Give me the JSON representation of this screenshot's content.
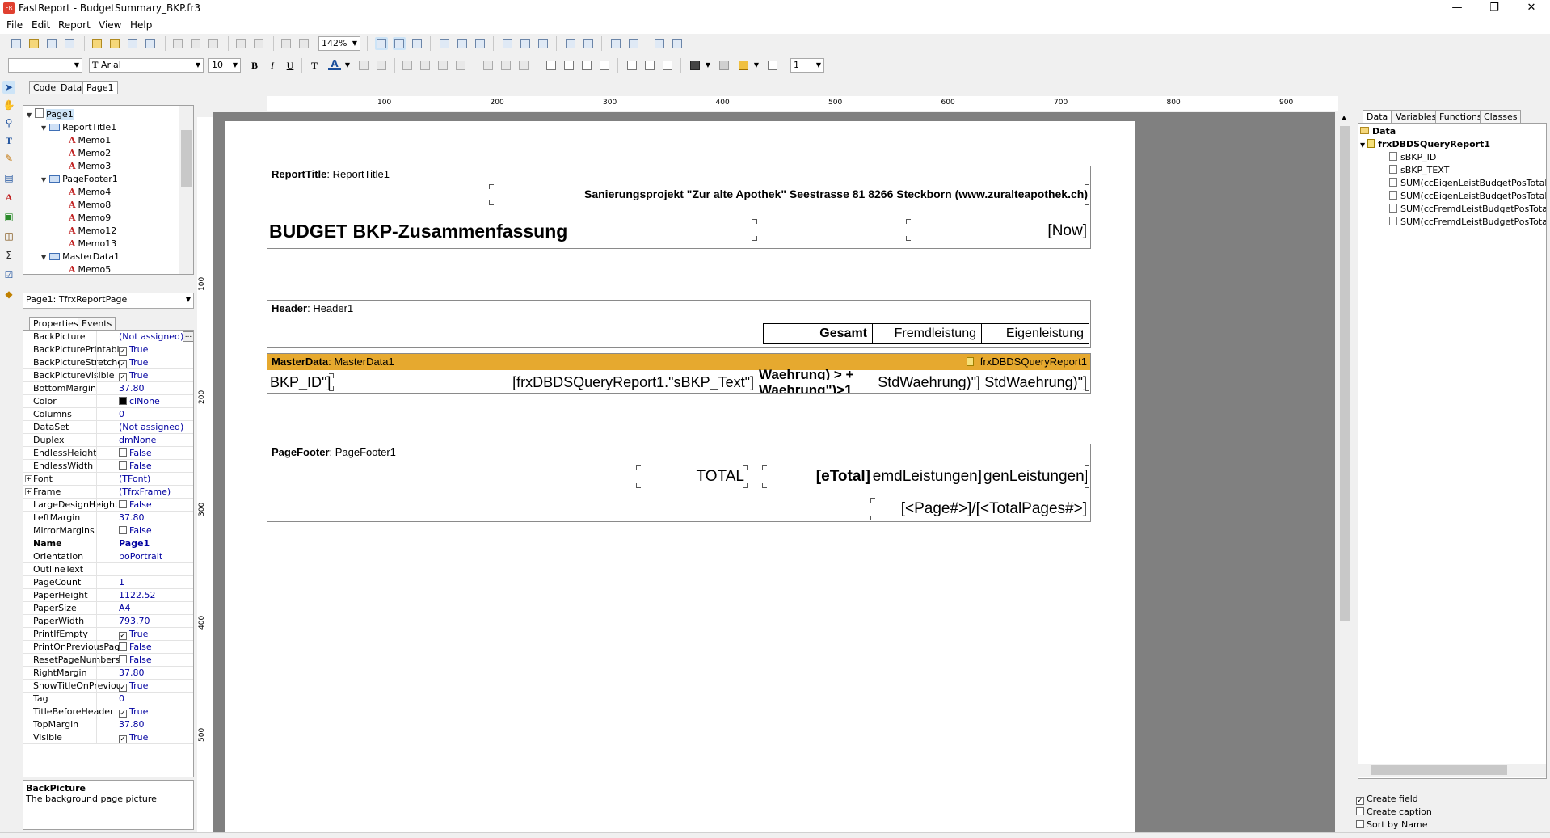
{
  "window": {
    "title": "FastReport - BudgetSummary_BKP.fr3",
    "app_icon": "FR"
  },
  "menu": [
    "File",
    "Edit",
    "Report",
    "View",
    "Help"
  ],
  "toolbar": {
    "zoom": "142%"
  },
  "format_toolbar": {
    "style_combo": "",
    "font_name": "Arial",
    "font_size": "10",
    "bold": "B",
    "italic": "I",
    "underline": "U",
    "frame_width": "1"
  },
  "designer_tabs": [
    "Code",
    "Data",
    "Page1"
  ],
  "report_tree": [
    {
      "label": "Page1",
      "level": 0,
      "type": "page",
      "expanded": true
    },
    {
      "label": "ReportTitle1",
      "level": 1,
      "type": "band",
      "expanded": true
    },
    {
      "label": "Memo1",
      "level": 2,
      "type": "memo"
    },
    {
      "label": "Memo2",
      "level": 2,
      "type": "memo"
    },
    {
      "label": "Memo3",
      "level": 2,
      "type": "memo"
    },
    {
      "label": "PageFooter1",
      "level": 1,
      "type": "band",
      "expanded": true
    },
    {
      "label": "Memo4",
      "level": 2,
      "type": "memo"
    },
    {
      "label": "Memo8",
      "level": 2,
      "type": "memo"
    },
    {
      "label": "Memo9",
      "level": 2,
      "type": "memo"
    },
    {
      "label": "Memo12",
      "level": 2,
      "type": "memo"
    },
    {
      "label": "Memo13",
      "level": 2,
      "type": "memo"
    },
    {
      "label": "MasterData1",
      "level": 1,
      "type": "band",
      "expanded": true
    },
    {
      "label": "Memo5",
      "level": 2,
      "type": "memo"
    }
  ],
  "object_combo": "Page1: TfrxReportPage",
  "inspector_tabs": [
    "Properties",
    "Events"
  ],
  "properties": [
    {
      "name": "BackPicture",
      "value": "(Not assigned)",
      "ellipsis": true
    },
    {
      "name": "BackPicturePrintable",
      "value": "True",
      "check": true
    },
    {
      "name": "BackPictureStretched",
      "value": "True",
      "check": true
    },
    {
      "name": "BackPictureVisible",
      "value": "True",
      "check": true
    },
    {
      "name": "BottomMargin",
      "value": "37.80"
    },
    {
      "name": "Color",
      "value": "clNone",
      "swatch": "#000000"
    },
    {
      "name": "Columns",
      "value": "0"
    },
    {
      "name": "DataSet",
      "value": "(Not assigned)"
    },
    {
      "name": "Duplex",
      "value": "dmNone"
    },
    {
      "name": "EndlessHeight",
      "value": "False",
      "check": false
    },
    {
      "name": "EndlessWidth",
      "value": "False",
      "check": false
    },
    {
      "name": "Font",
      "value": "(TFont)",
      "expandable": true
    },
    {
      "name": "Frame",
      "value": "(TfrxFrame)",
      "expandable": true
    },
    {
      "name": "LargeDesignHeight",
      "value": "False",
      "check": false
    },
    {
      "name": "LeftMargin",
      "value": "37.80"
    },
    {
      "name": "MirrorMargins",
      "value": "False",
      "check": false
    },
    {
      "name": "Name",
      "value": "Page1",
      "bold": true
    },
    {
      "name": "Orientation",
      "value": "poPortrait"
    },
    {
      "name": "OutlineText",
      "value": ""
    },
    {
      "name": "PageCount",
      "value": "1"
    },
    {
      "name": "PaperHeight",
      "value": "1122.52"
    },
    {
      "name": "PaperSize",
      "value": "A4"
    },
    {
      "name": "PaperWidth",
      "value": "793.70"
    },
    {
      "name": "PrintIfEmpty",
      "value": "True",
      "check": true
    },
    {
      "name": "PrintOnPreviousPage",
      "value": "False",
      "check": false
    },
    {
      "name": "ResetPageNumbers",
      "value": "False",
      "check": false
    },
    {
      "name": "RightMargin",
      "value": "37.80"
    },
    {
      "name": "ShowTitleOnPreviousPage",
      "value": "True",
      "check": true
    },
    {
      "name": "Tag",
      "value": "0"
    },
    {
      "name": "TitleBeforeHeader",
      "value": "True",
      "check": true
    },
    {
      "name": "TopMargin",
      "value": "37.80"
    },
    {
      "name": "Visible",
      "value": "True",
      "check": true
    }
  ],
  "help": {
    "title": "BackPicture",
    "text": "The background page picture"
  },
  "ruler_h": [
    "100",
    "200",
    "300",
    "400",
    "500",
    "600",
    "700",
    "800",
    "900"
  ],
  "ruler_v": [
    "100",
    "200",
    "300",
    "400",
    "500"
  ],
  "bands": {
    "report_title": {
      "type": "ReportTitle",
      "name": "ReportTitle1",
      "address": "Sanierungsprojekt \"Zur alte Apothek\" Seestrasse 81 8266 Steckborn  (www.zuralteapothek.ch)",
      "title": "BUDGET BKP-Zusammenfassung",
      "now": "[Now]"
    },
    "header": {
      "type": "Header",
      "name": "Header1",
      "col_total": "Gesamt",
      "col_external": "Fremdleistung",
      "col_own": "Eigenleistung"
    },
    "master": {
      "type": "MasterData",
      "name": "MasterData1",
      "dataset": "frxDBDSQueryReport1",
      "id_field": "BKP_ID\"]",
      "text_field": "[frxDBDSQueryReport1.\"sBKP_Text\"]",
      "overlap_top": "Waehrung) > +",
      "overlap_bottom": "Waehrung\")>1",
      "own_field": "StdWaehrung)\"]",
      "external_field": "StdWaehrung)\"]"
    },
    "page_footer": {
      "type": "PageFooter",
      "name": "PageFooter1",
      "total_label": "TOTAL",
      "total_value": "[eTotal]",
      "external_total": "emdLeistungen]",
      "own_total": "genLeistungen]",
      "page_numbers": "[<Page#>]/[<TotalPages#>]"
    }
  },
  "right_tabs": [
    "Data",
    "Variables",
    "Functions",
    "Classes"
  ],
  "data_tree": {
    "root": "Data",
    "dataset": "frxDBDSQueryReport1",
    "fields": [
      "sBKP_ID",
      "sBKP_TEXT",
      "SUM(ccEigenLeistBudgetPosTotal)",
      "SUM(ccEigenLeistBudgetPosTotalStdWaehrung)",
      "SUM(ccFremdLeistBudgetPosTotal)",
      "SUM(ccFremdLeistBudgetPosTotalStdWaehrung)"
    ]
  },
  "options": [
    {
      "label": "Create field",
      "checked": true
    },
    {
      "label": "Create caption",
      "checked": false
    },
    {
      "label": "Sort by Name",
      "checked": false
    }
  ],
  "colors": {
    "master_band": "#e6a92f",
    "workspace": "#808080"
  }
}
